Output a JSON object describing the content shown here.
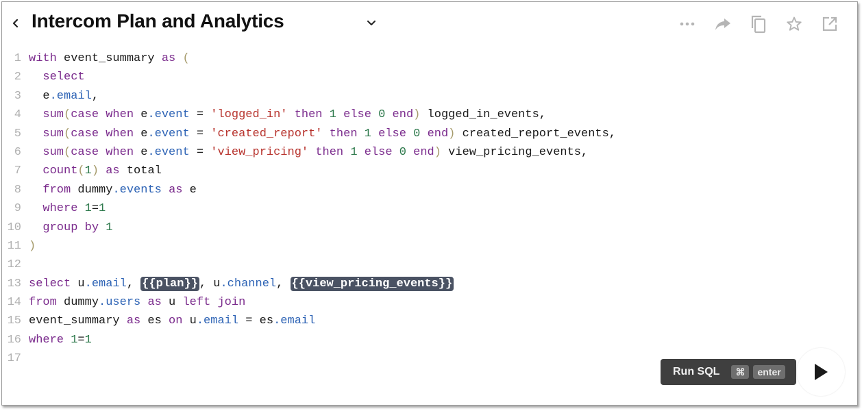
{
  "header": {
    "title": "Intercom Plan and Analytics",
    "icons": {
      "back": "chevron-left-icon",
      "dropdown": "chevron-down-icon",
      "more": "more-horizontal-icon",
      "share": "share-arrow-icon",
      "duplicate": "copy-icon",
      "favorite": "star-icon",
      "open": "external-link-icon"
    }
  },
  "editor": {
    "line_numbers": [
      "1",
      "2",
      "3",
      "4",
      "5",
      "6",
      "7",
      "8",
      "9",
      "10",
      "11",
      "12",
      "13",
      "14",
      "15",
      "16",
      "17"
    ],
    "lines": [
      [
        {
          "t": "kw",
          "v": "with"
        },
        {
          "t": "code",
          "v": " event_summary "
        },
        {
          "t": "kw",
          "v": "as"
        },
        {
          "t": "code",
          "v": " "
        },
        {
          "t": "paren",
          "v": "("
        }
      ],
      [
        {
          "t": "code",
          "v": "  "
        },
        {
          "t": "kw",
          "v": "select"
        }
      ],
      [
        {
          "t": "code",
          "v": "  e"
        },
        {
          "t": "prop",
          "v": ".email"
        },
        {
          "t": "code",
          "v": ","
        }
      ],
      [
        {
          "t": "code",
          "v": "  "
        },
        {
          "t": "kw",
          "v": "sum"
        },
        {
          "t": "paren",
          "v": "("
        },
        {
          "t": "kw",
          "v": "case when"
        },
        {
          "t": "code",
          "v": " e"
        },
        {
          "t": "prop",
          "v": ".event"
        },
        {
          "t": "code",
          "v": " = "
        },
        {
          "t": "str",
          "v": "'logged_in'"
        },
        {
          "t": "code",
          "v": " "
        },
        {
          "t": "kw",
          "v": "then"
        },
        {
          "t": "code",
          "v": " "
        },
        {
          "t": "num",
          "v": "1"
        },
        {
          "t": "code",
          "v": " "
        },
        {
          "t": "kw",
          "v": "else"
        },
        {
          "t": "code",
          "v": " "
        },
        {
          "t": "num",
          "v": "0"
        },
        {
          "t": "code",
          "v": " "
        },
        {
          "t": "kw",
          "v": "end"
        },
        {
          "t": "paren",
          "v": ")"
        },
        {
          "t": "code",
          "v": " logged_in_events,"
        }
      ],
      [
        {
          "t": "code",
          "v": "  "
        },
        {
          "t": "kw",
          "v": "sum"
        },
        {
          "t": "paren",
          "v": "("
        },
        {
          "t": "kw",
          "v": "case when"
        },
        {
          "t": "code",
          "v": " e"
        },
        {
          "t": "prop",
          "v": ".event"
        },
        {
          "t": "code",
          "v": " = "
        },
        {
          "t": "str",
          "v": "'created_report'"
        },
        {
          "t": "code",
          "v": " "
        },
        {
          "t": "kw",
          "v": "then"
        },
        {
          "t": "code",
          "v": " "
        },
        {
          "t": "num",
          "v": "1"
        },
        {
          "t": "code",
          "v": " "
        },
        {
          "t": "kw",
          "v": "else"
        },
        {
          "t": "code",
          "v": " "
        },
        {
          "t": "num",
          "v": "0"
        },
        {
          "t": "code",
          "v": " "
        },
        {
          "t": "kw",
          "v": "end"
        },
        {
          "t": "paren",
          "v": ")"
        },
        {
          "t": "code",
          "v": " created_report_events,"
        }
      ],
      [
        {
          "t": "code",
          "v": "  "
        },
        {
          "t": "kw",
          "v": "sum"
        },
        {
          "t": "paren",
          "v": "("
        },
        {
          "t": "kw",
          "v": "case when"
        },
        {
          "t": "code",
          "v": " e"
        },
        {
          "t": "prop",
          "v": ".event"
        },
        {
          "t": "code",
          "v": " = "
        },
        {
          "t": "str",
          "v": "'view_pricing'"
        },
        {
          "t": "code",
          "v": " "
        },
        {
          "t": "kw",
          "v": "then"
        },
        {
          "t": "code",
          "v": " "
        },
        {
          "t": "num",
          "v": "1"
        },
        {
          "t": "code",
          "v": " "
        },
        {
          "t": "kw",
          "v": "else"
        },
        {
          "t": "code",
          "v": " "
        },
        {
          "t": "num",
          "v": "0"
        },
        {
          "t": "code",
          "v": " "
        },
        {
          "t": "kw",
          "v": "end"
        },
        {
          "t": "paren",
          "v": ")"
        },
        {
          "t": "code",
          "v": " view_pricing_events,"
        }
      ],
      [
        {
          "t": "code",
          "v": "  "
        },
        {
          "t": "kw",
          "v": "count"
        },
        {
          "t": "paren",
          "v": "("
        },
        {
          "t": "num",
          "v": "1"
        },
        {
          "t": "paren",
          "v": ")"
        },
        {
          "t": "code",
          "v": " "
        },
        {
          "t": "kw",
          "v": "as"
        },
        {
          "t": "code",
          "v": " total"
        }
      ],
      [
        {
          "t": "code",
          "v": "  "
        },
        {
          "t": "kw",
          "v": "from"
        },
        {
          "t": "code",
          "v": " dummy"
        },
        {
          "t": "prop",
          "v": ".events"
        },
        {
          "t": "code",
          "v": " "
        },
        {
          "t": "kw",
          "v": "as"
        },
        {
          "t": "code",
          "v": " e"
        }
      ],
      [
        {
          "t": "code",
          "v": "  "
        },
        {
          "t": "kw",
          "v": "where"
        },
        {
          "t": "code",
          "v": " "
        },
        {
          "t": "num",
          "v": "1"
        },
        {
          "t": "code",
          "v": "="
        },
        {
          "t": "num",
          "v": "1"
        }
      ],
      [
        {
          "t": "code",
          "v": "  "
        },
        {
          "t": "kw",
          "v": "group by"
        },
        {
          "t": "code",
          "v": " "
        },
        {
          "t": "num",
          "v": "1"
        }
      ],
      [
        {
          "t": "paren",
          "v": ")"
        }
      ],
      [],
      [
        {
          "t": "kw",
          "v": "select"
        },
        {
          "t": "code",
          "v": " u"
        },
        {
          "t": "prop",
          "v": ".email"
        },
        {
          "t": "code",
          "v": ", "
        },
        {
          "t": "tpl",
          "v": "{{plan}}"
        },
        {
          "t": "code",
          "v": ", u"
        },
        {
          "t": "prop",
          "v": ".channel"
        },
        {
          "t": "code",
          "v": ", "
        },
        {
          "t": "tpl",
          "v": "{{view_pricing_events}}"
        }
      ],
      [
        {
          "t": "kw",
          "v": "from"
        },
        {
          "t": "code",
          "v": " dummy"
        },
        {
          "t": "prop",
          "v": ".users"
        },
        {
          "t": "code",
          "v": " "
        },
        {
          "t": "kw",
          "v": "as"
        },
        {
          "t": "code",
          "v": " u "
        },
        {
          "t": "kw",
          "v": "left join"
        }
      ],
      [
        {
          "t": "code",
          "v": "event_summary "
        },
        {
          "t": "kw",
          "v": "as"
        },
        {
          "t": "code",
          "v": " es "
        },
        {
          "t": "kw",
          "v": "on"
        },
        {
          "t": "code",
          "v": " u"
        },
        {
          "t": "prop",
          "v": ".email"
        },
        {
          "t": "code",
          "v": " = es"
        },
        {
          "t": "prop",
          "v": ".email"
        }
      ],
      [
        {
          "t": "kw",
          "v": "where"
        },
        {
          "t": "code",
          "v": " "
        },
        {
          "t": "num",
          "v": "1"
        },
        {
          "t": "code",
          "v": "="
        },
        {
          "t": "num",
          "v": "1"
        }
      ],
      []
    ]
  },
  "run": {
    "label": "Run SQL",
    "shortcut_key": "⌘",
    "shortcut_enter": "enter",
    "play_icon": "play-icon"
  }
}
